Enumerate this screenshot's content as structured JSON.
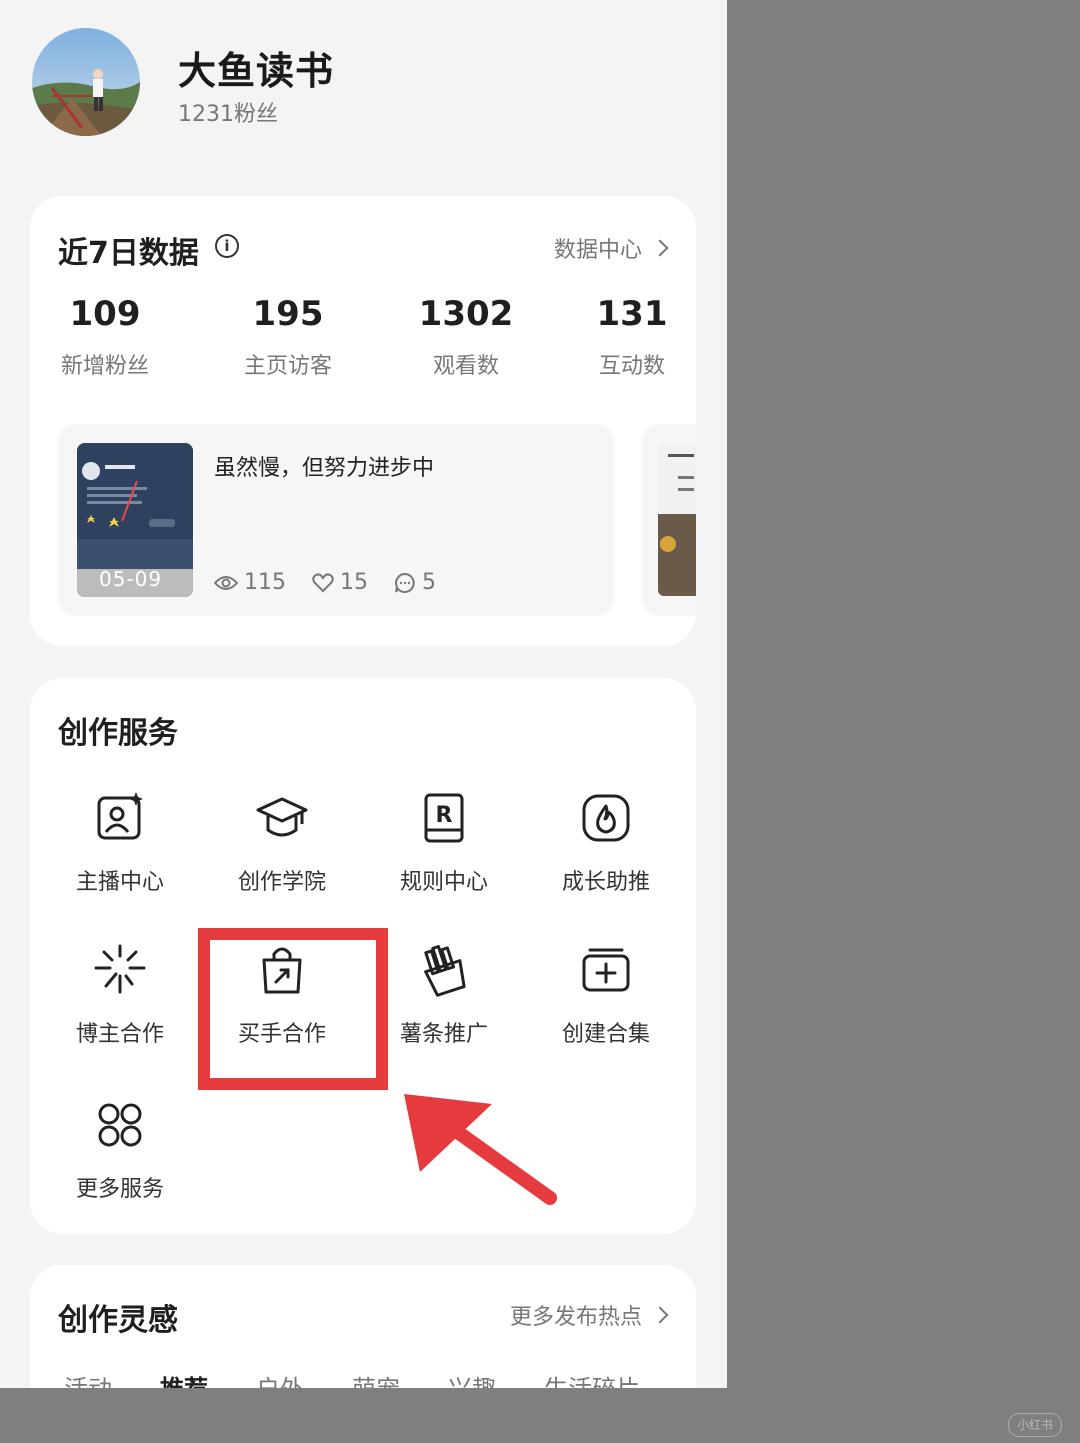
{
  "profile": {
    "name": "大鱼读书",
    "fans": "1231粉丝"
  },
  "data_card": {
    "title": "近7日数据",
    "info_glyph": "i",
    "link": "数据中心",
    "stats": [
      {
        "value": "109",
        "label": "新增粉丝"
      },
      {
        "value": "195",
        "label": "主页访客"
      },
      {
        "value": "1302",
        "label": "观看数"
      },
      {
        "value": "131",
        "label": "互动数"
      }
    ],
    "post": {
      "title": "虽然慢，但努力进步中",
      "date": "05-09",
      "views": "115",
      "likes": "15",
      "comments": "5"
    }
  },
  "services_card": {
    "title": "创作服务",
    "items": [
      {
        "label": "主播中心",
        "icon": "streamer-center-icon"
      },
      {
        "label": "创作学院",
        "icon": "graduation-cap-icon"
      },
      {
        "label": "规则中心",
        "icon": "rules-book-icon"
      },
      {
        "label": "成长助推",
        "icon": "flame-icon"
      },
      {
        "label": "博主合作",
        "icon": "sparkle-burst-icon"
      },
      {
        "label": "买手合作",
        "icon": "shopping-bag-icon"
      },
      {
        "label": "薯条推广",
        "icon": "fries-icon"
      },
      {
        "label": "创建合集",
        "icon": "add-collection-icon"
      },
      {
        "label": "更多服务",
        "icon": "grid-circles-icon"
      }
    ]
  },
  "inspire_card": {
    "title": "创作灵感",
    "link": "更多发布热点",
    "tabs": [
      {
        "label": "活动"
      },
      {
        "label": "推荐",
        "active": true
      },
      {
        "label": "户外"
      },
      {
        "label": "萌宠"
      },
      {
        "label": "兴趣"
      },
      {
        "label": "生活碎片"
      }
    ]
  },
  "annotation": {
    "color": "#e53a3e"
  },
  "watermark": "小红书"
}
